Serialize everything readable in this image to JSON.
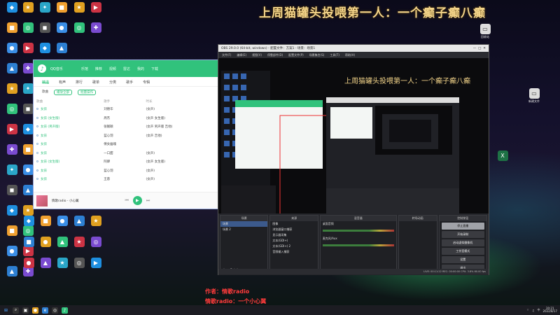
{
  "banner": "上周猫罐头投喂第一人：一个癫子癫八癫",
  "desktop_icons_left": [
    {
      "label": "QQ",
      "icon": "app-icon",
      "color": "#1e8fe0"
    },
    {
      "label": "Steam",
      "icon": "app-icon",
      "color": "#1b2838"
    },
    {
      "label": "Google Chrome",
      "icon": "chrome-icon",
      "color": "#e0a020"
    },
    {
      "label": "Microsoft Edge",
      "icon": "edge-icon",
      "color": "#2d7fd2"
    },
    {
      "label": "OBS Studio",
      "icon": "obs-icon",
      "color": "#333"
    },
    {
      "label": "Internet Explorer",
      "icon": "ie-icon",
      "color": "#2a84d8"
    }
  ],
  "music": {
    "app_title": "QQ音乐",
    "top_nav": [
      "乐馆",
      "推荐",
      "视频",
      "雷达",
      "我的",
      "下载"
    ],
    "tabs": [
      "精选",
      "有声",
      "排行",
      "歌单",
      "分类",
      "歌手",
      "专辑"
    ],
    "active_tab": "精选",
    "sub_tabs": [
      "歌曲",
      "播放全部",
      "批量操作"
    ],
    "columns": [
      "歌曲",
      "歌手",
      "时长"
    ],
    "rows": [
      {
        "title": "女孩",
        "artist": "刘德华",
        "time": "(女声)"
      },
      {
        "title": "女孩 (女生版)",
        "artist": "周杰",
        "time": "(女声 女生版)"
      },
      {
        "title": "女孩 (男声版)",
        "artist": "张靓颖",
        "time": "(女声 男声版 吉他)"
      },
      {
        "title": "女孩",
        "artist": "蓝心羽",
        "time": "(女声 吉他)"
      },
      {
        "title": "女孩",
        "artist": "倩女幽魂",
        "time": ""
      },
      {
        "title": "女孩",
        "artist": "一口甜",
        "time": "(女声)"
      },
      {
        "title": "女孩 (女生版)",
        "artist": "阿肆",
        "time": "(女声 女生版)"
      },
      {
        "title": "女孩",
        "artist": "蓝心羽",
        "time": "(女声)"
      },
      {
        "title": "女孩",
        "artist": "王蓉",
        "time": "(女声)"
      }
    ],
    "now_playing": "情歌radio - 小心翼"
  },
  "obs": {
    "title": "OBS 29.0.0 (64-bit, windows) - 配置文件：方案1 - 场景：场景1",
    "menu": [
      "文件(F)",
      "编辑(E)",
      "视图(V)",
      "停靠部件(D)",
      "配置文件(P)",
      "场景集合(S)",
      "工具(T)",
      "帮助(H)"
    ],
    "scene_title": "上周猫罐头投喂第一人：一个癫子癫八癫",
    "panels": {
      "scenes_header": "场景",
      "scenes": [
        "场景",
        "场景 2"
      ],
      "sources_header": "来源",
      "sources": [
        "图像",
        "浏览器窗口捕获",
        "显示器采集",
        "文本(GDI+)",
        "文本(GDI+) 2",
        "音频输入捕获"
      ],
      "mixer_header": "混音器",
      "mixer": [
        "桌面音频",
        "麦克风/Aux"
      ],
      "transitions_header": "转场动画",
      "controls_header": "控制按钮",
      "controls": [
        "停止直播",
        "开始录制",
        "启动虚拟摄像机",
        "工作室模式",
        "设置",
        "退出"
      ]
    },
    "status": "LIVE: 00:11:22  REC: 00:00:00  CPU: 3.8%  60.00 fps"
  },
  "overlay_red": "作者：情歌radio",
  "overlay_yellow": "情歌radio：一个小心翼",
  "taskbar": {
    "time": "20:21",
    "date": "2022/8/17"
  },
  "desktop_icons_right": [
    {
      "label": "回收站",
      "icon": "file-icon",
      "color": "#ddd"
    },
    {
      "label": "新建文件",
      "icon": "file-icon",
      "color": "#ddd"
    }
  ]
}
